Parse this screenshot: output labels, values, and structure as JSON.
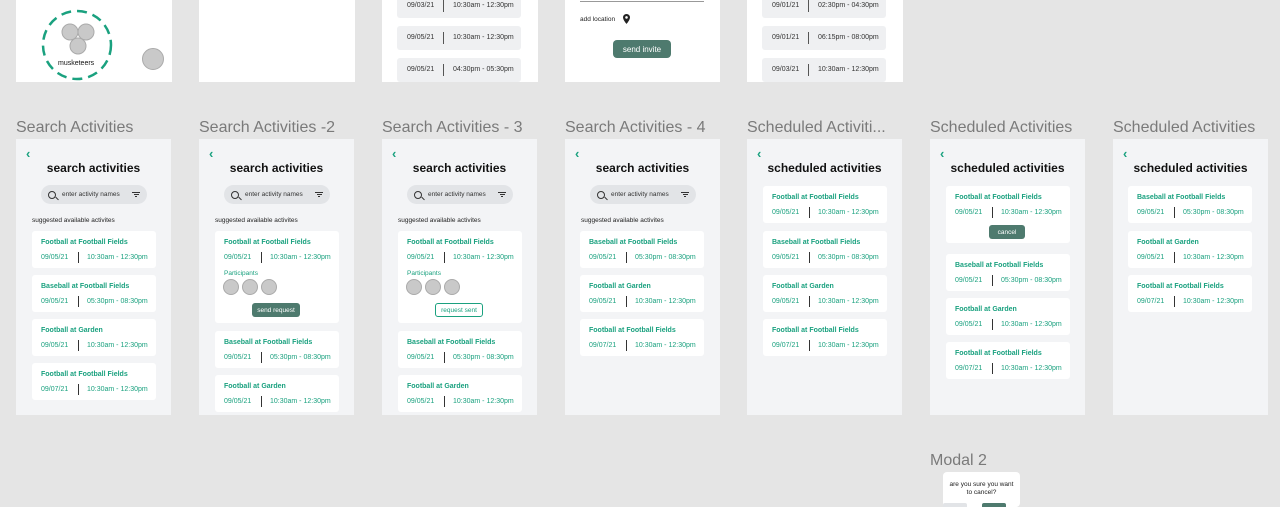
{
  "top_frames": {
    "group": {
      "name": "musketeers"
    },
    "list_a": {
      "rows": [
        {
          "date": "09/03/21",
          "time": "10:30am - 12:30pm"
        },
        {
          "date": "09/05/21",
          "time": "10:30am - 12:30pm"
        },
        {
          "date": "09/05/21",
          "time": "04:30pm - 05:30pm"
        }
      ]
    },
    "invite": {
      "add_location": "add location",
      "send_invite": "send invite"
    },
    "list_b": {
      "rows": [
        {
          "date": "09/01/21",
          "time": "02:30pm - 04:30pm"
        },
        {
          "date": "09/01/21",
          "time": "06:15pm - 08:00pm"
        },
        {
          "date": "09/03/21",
          "time": "10:30am - 12:30pm"
        }
      ]
    }
  },
  "frames": [
    {
      "label": "Search Activities",
      "title": "search activities",
      "search_placeholder": "enter activity names",
      "suggest": "suggested available activites",
      "cards": [
        {
          "name": "Football at Football Fields",
          "date": "09/05/21",
          "time": "10:30am - 12:30pm"
        },
        {
          "name": "Baseball at Football Fields",
          "date": "09/05/21",
          "time": "05:30pm - 08:30pm"
        },
        {
          "name": "Football at Garden",
          "date": "09/05/21",
          "time": "10:30am - 12:30pm"
        },
        {
          "name": "Football at Football Fields",
          "date": "09/07/21",
          "time": "10:30am - 12:30pm"
        }
      ]
    },
    {
      "label": "Search Activities -2",
      "title": "search activities",
      "search_placeholder": "enter activity names",
      "suggest": "suggested available activites",
      "participants_label": "Participants",
      "action": "send request",
      "cards": [
        {
          "name": "Football at Football Fields",
          "date": "09/05/21",
          "time": "10:30am - 12:30pm"
        },
        {
          "name": "Baseball at Football Fields",
          "date": "09/05/21",
          "time": "05:30pm - 08:30pm"
        },
        {
          "name": "Football at Garden",
          "date": "09/05/21",
          "time": "10:30am - 12:30pm"
        }
      ]
    },
    {
      "label": "Search Activities - 3",
      "title": "search activities",
      "search_placeholder": "enter activity names",
      "suggest": "suggested available activites",
      "participants_label": "Participants",
      "action": "request sent",
      "cards": [
        {
          "name": "Football at Football Fields",
          "date": "09/05/21",
          "time": "10:30am - 12:30pm"
        },
        {
          "name": "Baseball at Football Fields",
          "date": "09/05/21",
          "time": "05:30pm - 08:30pm"
        },
        {
          "name": "Football at Garden",
          "date": "09/05/21",
          "time": "10:30am - 12:30pm"
        }
      ]
    },
    {
      "label": "Search Activities - 4",
      "title": "search activities",
      "search_placeholder": "enter activity names",
      "suggest": "suggested available activites",
      "cards": [
        {
          "name": "Baseball at Football Fields",
          "date": "09/05/21",
          "time": "05:30pm - 08:30pm"
        },
        {
          "name": "Football at Garden",
          "date": "09/05/21",
          "time": "10:30am - 12:30pm"
        },
        {
          "name": "Football at Football Fields",
          "date": "09/07/21",
          "time": "10:30am - 12:30pm"
        }
      ]
    },
    {
      "label": "Scheduled Activiti...",
      "title": "scheduled activities",
      "cards": [
        {
          "name": "Football at Football Fields",
          "date": "09/05/21",
          "time": "10:30am - 12:30pm"
        },
        {
          "name": "Baseball at Football Fields",
          "date": "09/05/21",
          "time": "05:30pm - 08:30pm"
        },
        {
          "name": "Football at Garden",
          "date": "09/05/21",
          "time": "10:30am - 12:30pm"
        },
        {
          "name": "Football at Football Fields",
          "date": "09/07/21",
          "time": "10:30am - 12:30pm"
        }
      ]
    },
    {
      "label": "Scheduled Activities",
      "title": "scheduled activities",
      "action": "cancel",
      "cards": [
        {
          "name": "Football at Football Fields",
          "date": "09/05/21",
          "time": "10:30am - 12:30pm"
        },
        {
          "name": "Baseball at Football Fields",
          "date": "09/05/21",
          "time": "05:30pm - 08:30pm"
        },
        {
          "name": "Football at Garden",
          "date": "09/05/21",
          "time": "10:30am - 12:30pm"
        },
        {
          "name": "Football at Football Fields",
          "date": "09/07/21",
          "time": "10:30am - 12:30pm"
        }
      ]
    },
    {
      "label": "Scheduled Activities",
      "title": "scheduled activities",
      "cards": [
        {
          "name": "Baseball at Football Fields",
          "date": "09/05/21",
          "time": "05:30pm - 08:30pm"
        },
        {
          "name": "Football at Garden",
          "date": "09/05/21",
          "time": "10:30am - 12:30pm"
        },
        {
          "name": "Football at Football Fields",
          "date": "09/07/21",
          "time": "10:30am - 12:30pm"
        }
      ]
    }
  ],
  "modal": {
    "label": "Modal 2",
    "question": "are you sure you want to cancel?"
  },
  "colors": {
    "accent": "#1aa17f",
    "button": "#4e7a6e",
    "canvas": "#e5e5e5",
    "frame": "#f3f4f6"
  }
}
